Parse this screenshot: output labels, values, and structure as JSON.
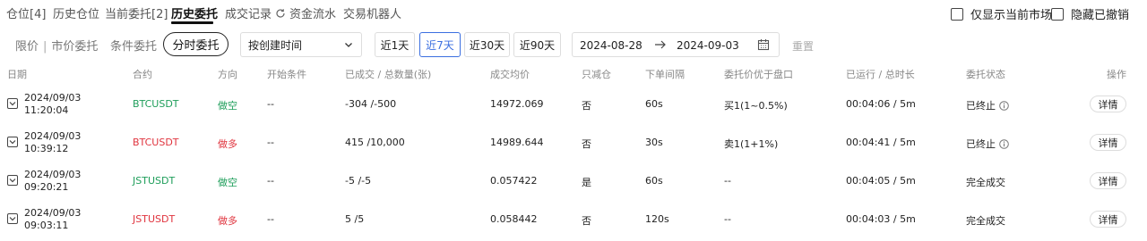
{
  "tabs": [
    {
      "label": "仓位[4]",
      "active": false
    },
    {
      "label": "历史仓位",
      "active": false
    },
    {
      "label": "当前委托[2]",
      "active": false
    },
    {
      "label": "历史委托",
      "active": true
    },
    {
      "label": "成交记录",
      "active": false
    },
    {
      "label": "资金流水",
      "active": false
    },
    {
      "label": "交易机器人",
      "active": false
    }
  ],
  "options": {
    "current_market_only": "仅显示当前市场",
    "hide_cancelled": "隐藏已撤销"
  },
  "filters": {
    "limit_market": "限价",
    "separator": "|",
    "market_order": "市价委托",
    "conditional": "条件委托",
    "twap": "分时委托",
    "sort_select": "按创建时间",
    "ranges": [
      "近1天",
      "近7天",
      "近30天",
      "近90天"
    ],
    "active_range": "近7天",
    "date_from": "2024-08-28",
    "date_to": "2024-09-03",
    "reset": "重置"
  },
  "table": {
    "headers": [
      "日期",
      "合约",
      "方向",
      "开始条件",
      "已成交 / 总数量(张)",
      "成交均价",
      "只减仓",
      "下单间隔",
      "委托价优于盘口",
      "已运行 / 总时长",
      "委托状态",
      "操作"
    ],
    "rows": [
      {
        "date": "2024/09/03",
        "time": "11:20:04",
        "contract": "BTCUSDT",
        "side": "做空",
        "side_color": "#1e9e5a",
        "start_condition": "--",
        "filled_total": "-304 /-500",
        "avg_price": "14972.069",
        "reduce_only": "否",
        "interval": "60s",
        "price_better": "买1(1~0.5%)",
        "runtime": "00:04:06 / 5m",
        "status": "已终止",
        "has_info": true,
        "action": "详情"
      },
      {
        "date": "2024/09/03",
        "time": "10:39:12",
        "contract": "BTCUSDT",
        "side": "做多",
        "side_color": "#e0343e",
        "start_condition": "--",
        "filled_total": "415 /10,000",
        "avg_price": "14989.644",
        "reduce_only": "否",
        "interval": "30s",
        "price_better": "卖1(1+1%)",
        "runtime": "00:04:41 / 5m",
        "status": "已终止",
        "has_info": true,
        "action": "详情"
      },
      {
        "date": "2024/09/03",
        "time": "09:20:21",
        "contract": "JSTUSDT",
        "side": "做空",
        "side_color": "#1e9e5a",
        "start_condition": "--",
        "filled_total": "-5 /-5",
        "avg_price": "0.057422",
        "reduce_only": "是",
        "interval": "60s",
        "price_better": "--",
        "runtime": "00:04:05 / 5m",
        "status": "完全成交",
        "has_info": false,
        "action": "详情"
      },
      {
        "date": "2024/09/03",
        "time": "09:03:11",
        "contract": "JSTUSDT",
        "side": "做多",
        "side_color": "#e0343e",
        "start_condition": "--",
        "filled_total": "5 /5",
        "avg_price": "0.058442",
        "reduce_only": "否",
        "interval": "120s",
        "price_better": "--",
        "runtime": "00:04:03 / 5m",
        "status": "完全成交",
        "has_info": false,
        "action": "详情"
      }
    ]
  }
}
